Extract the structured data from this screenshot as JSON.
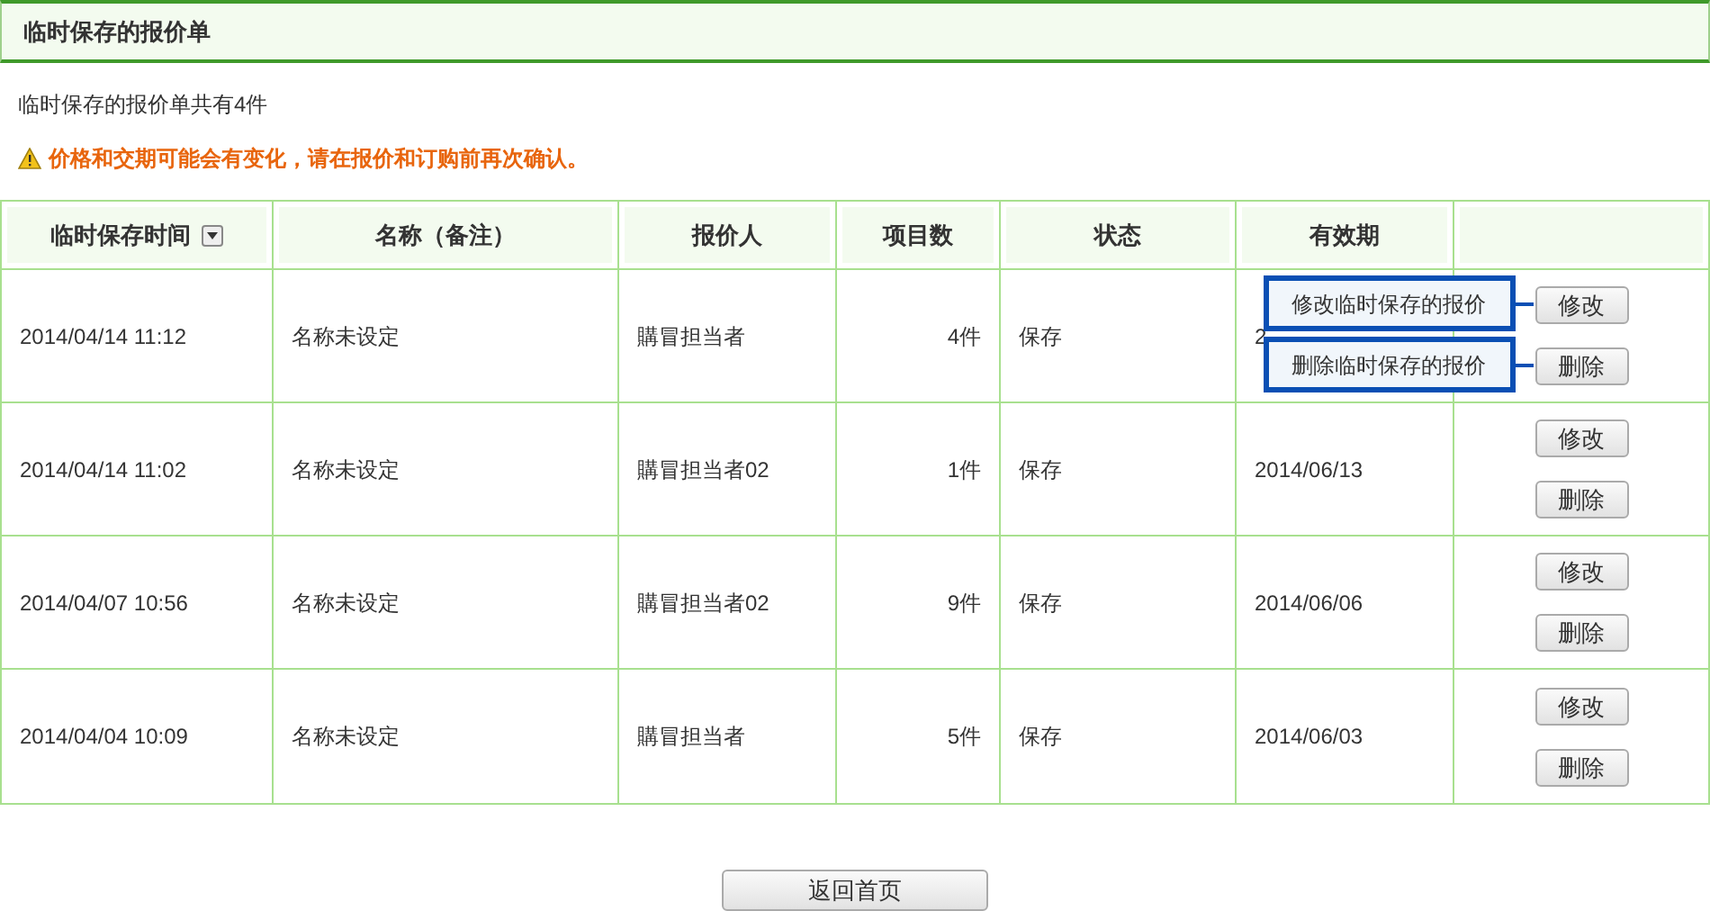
{
  "title": "临时保存的报价单",
  "summary": "临时保存的报价单共有4件",
  "warning": "价格和交期可能会有变化，请在报价和订购前再次确认。",
  "table": {
    "columns": [
      {
        "label": "临时保存时间",
        "sortable": true
      },
      {
        "label": "名称（备注）",
        "sortable": false
      },
      {
        "label": "报价人",
        "sortable": false
      },
      {
        "label": "项目数",
        "sortable": false
      },
      {
        "label": "状态",
        "sortable": false
      },
      {
        "label": "有效期",
        "sortable": false
      }
    ],
    "rows": [
      {
        "time": "2014/04/14 11:12",
        "name": "名称未设定",
        "person": "購冒担当者",
        "count": "4件",
        "status": "保存",
        "valid": "2",
        "buttons": [
          {
            "label": "修改",
            "tooltip": "修改临时保存的报价"
          },
          {
            "label": "删除",
            "tooltip": "删除临时保存的报价"
          }
        ]
      },
      {
        "time": "2014/04/14 11:02",
        "name": "名称未设定",
        "person": "購冒担当者02",
        "count": "1件",
        "status": "保存",
        "valid": "2014/06/13",
        "buttons": [
          {
            "label": "修改"
          },
          {
            "label": "删除"
          }
        ]
      },
      {
        "time": "2014/04/07 10:56",
        "name": "名称未设定",
        "person": "購冒担当者02",
        "count": "9件",
        "status": "保存",
        "valid": "2014/06/06",
        "buttons": [
          {
            "label": "修改"
          },
          {
            "label": "删除"
          }
        ]
      },
      {
        "time": "2014/04/04 10:09",
        "name": "名称未设定",
        "person": "購冒担当者",
        "count": "5件",
        "status": "保存",
        "valid": "2014/06/03",
        "buttons": [
          {
            "label": "修改"
          },
          {
            "label": "删除"
          }
        ]
      }
    ]
  },
  "footer_button": "返回首页"
}
